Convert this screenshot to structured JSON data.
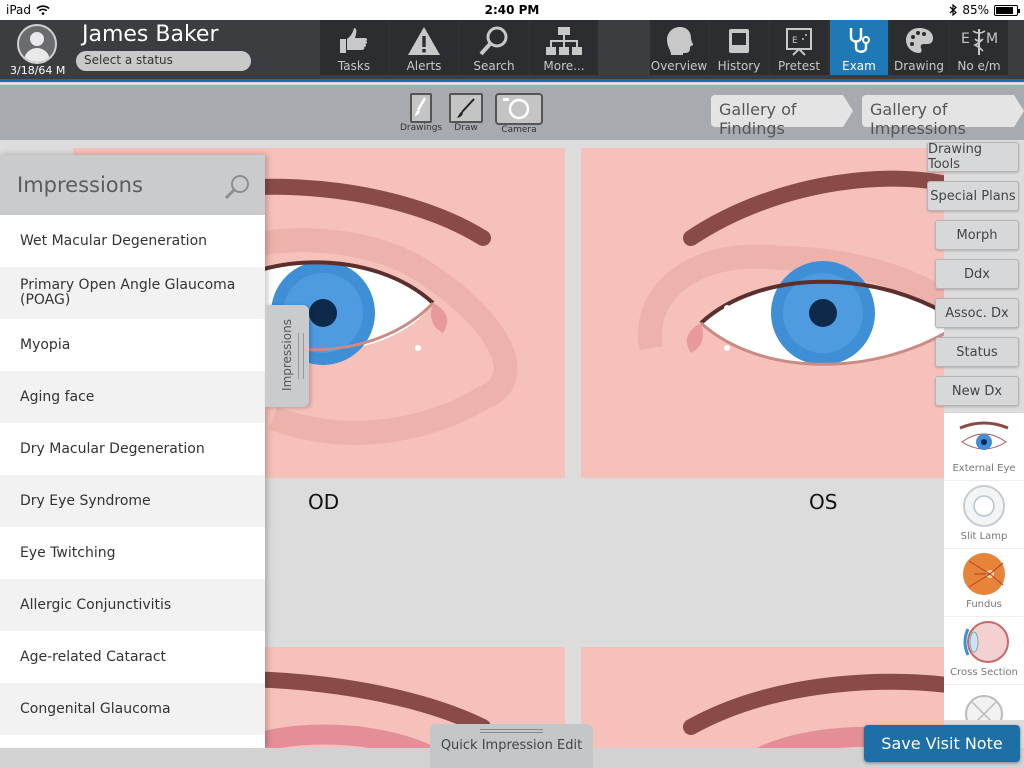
{
  "status_bar": {
    "device": "iPad",
    "time": "2:40 PM",
    "battery": "85%",
    "battery_level": 0.85
  },
  "patient": {
    "name": "James Baker",
    "dob": "3/18/64 M",
    "status_placeholder": "Select a status"
  },
  "nav_left": [
    {
      "label": "Tasks",
      "icon": "hand-icon"
    },
    {
      "label": "Alerts",
      "icon": "alert-icon"
    },
    {
      "label": "Search",
      "icon": "search-icon"
    },
    {
      "label": "More...",
      "icon": "sitemap-icon"
    }
  ],
  "nav_right": [
    {
      "label": "Overview",
      "icon": "head-icon",
      "active": false
    },
    {
      "label": "History",
      "icon": "history-icon",
      "active": false
    },
    {
      "label": "Pretest",
      "icon": "pretest-icon",
      "active": false
    },
    {
      "label": "Exam",
      "icon": "stethoscope-icon",
      "active": true
    },
    {
      "label": "Drawing",
      "icon": "palette-icon",
      "active": false
    },
    {
      "label": "No e/m",
      "icon": "em-icon",
      "active": false
    }
  ],
  "toolbar": {
    "drawings": "Drawings",
    "draw": "Draw",
    "camera": "Camera",
    "gallery_findings": "Gallery of Findings",
    "gallery_impressions": "Gallery of Impressions"
  },
  "eyes": {
    "od": "OD",
    "os": "OS"
  },
  "impressions": {
    "title": "Impressions",
    "tab_label": "Impressions",
    "items": [
      "Wet Macular Degeneration",
      "Primary Open Angle Glaucoma (POAG)",
      "Myopia",
      "Aging face",
      "Dry Macular Degeneration",
      "Dry Eye Syndrome",
      "Eye Twitching",
      "Allergic Conjunctivitis",
      "Age-related Cataract",
      "Congenital Glaucoma"
    ]
  },
  "side_buttons": [
    "Drawing Tools",
    "Special Plans",
    "Morph",
    "Ddx",
    "Assoc. Dx",
    "Status",
    "New Dx"
  ],
  "thumbnails": [
    "External Eye",
    "Slit Lamp",
    "Fundus",
    "Cross Section",
    ""
  ],
  "bottom": {
    "quick_edit": "Quick Impression Edit",
    "save": "Save Visit Note"
  },
  "colors": {
    "accent": "#1e79b6",
    "header_bg": "#3b3d40",
    "skin": "#f6c1ba",
    "iris": "#3f8fd6"
  }
}
